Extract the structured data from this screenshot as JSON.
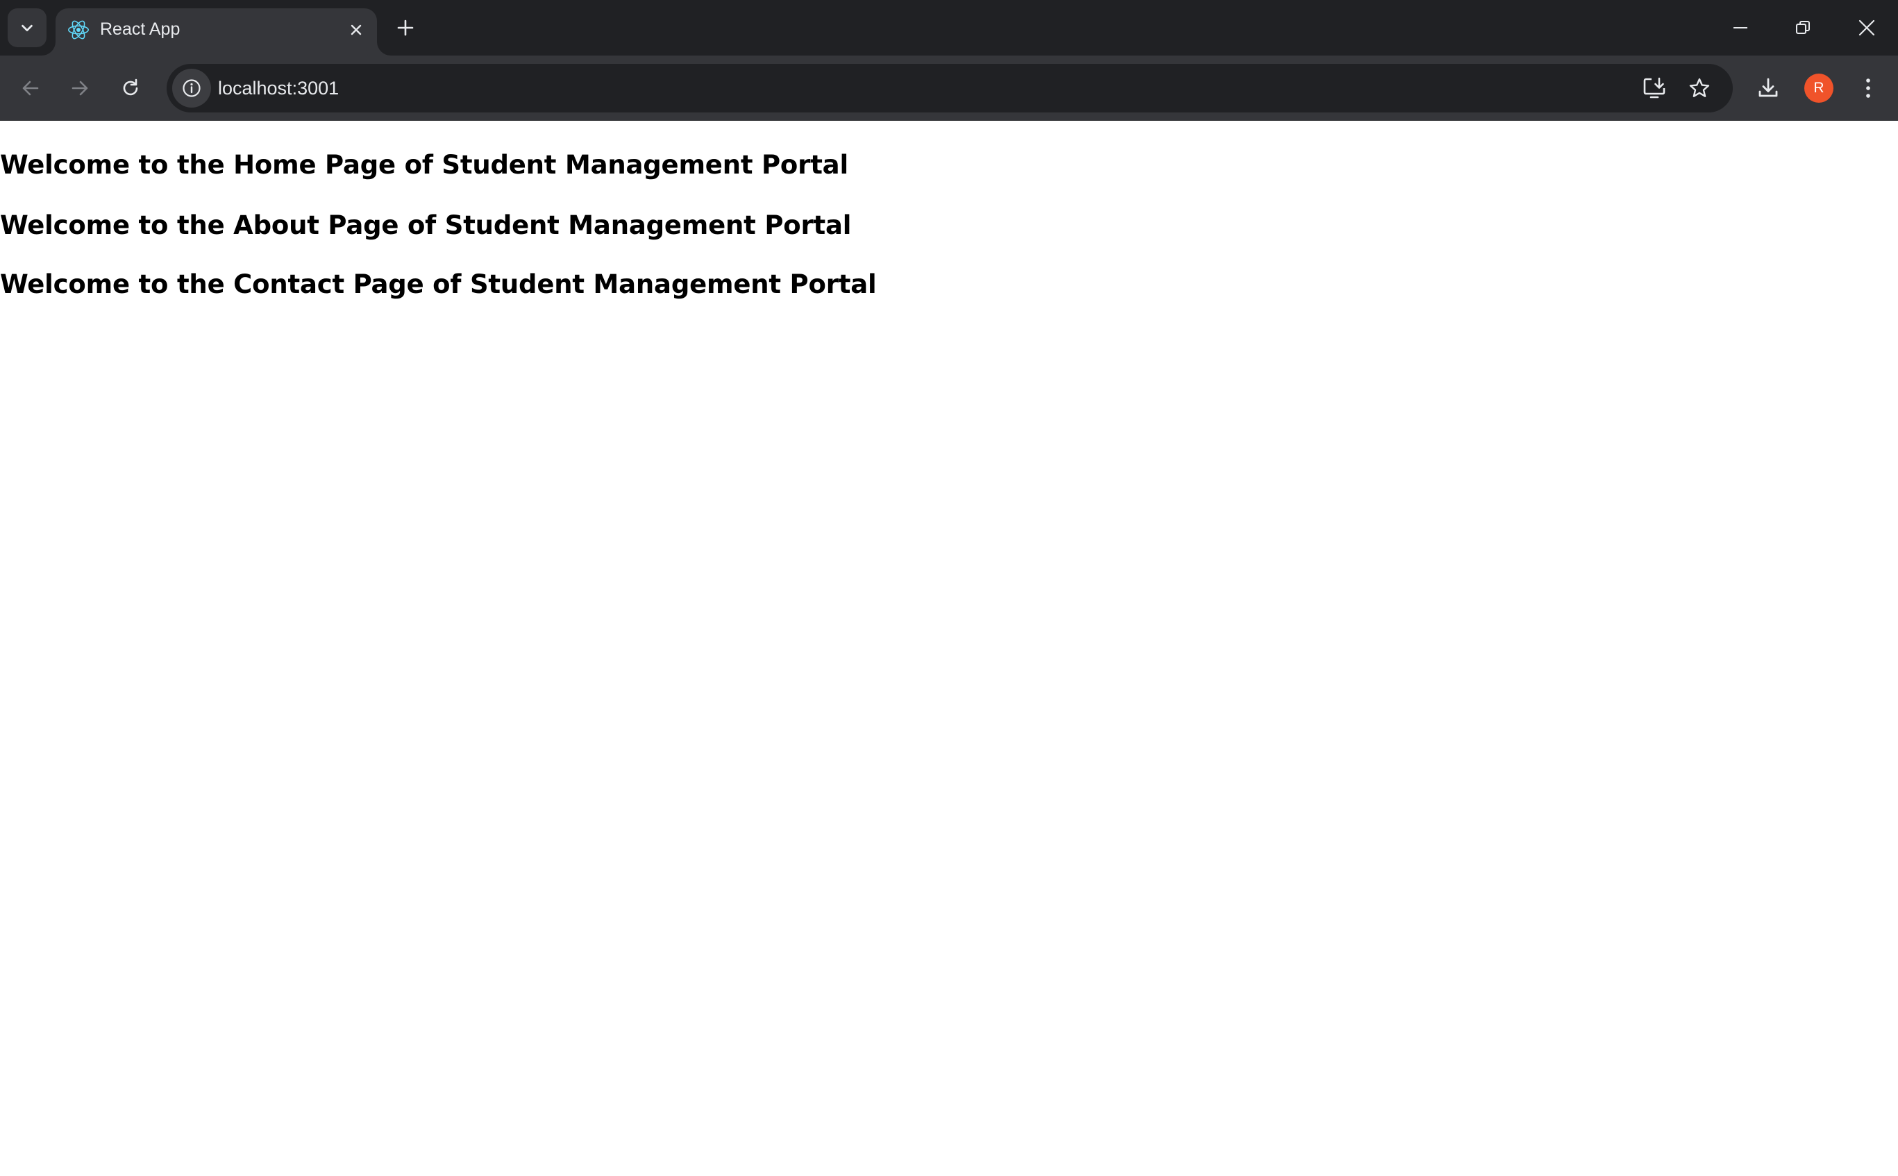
{
  "browser": {
    "tab": {
      "title": "React App",
      "favicon": "react-logo-icon"
    },
    "address_bar": {
      "url": "localhost:3001"
    },
    "profile_initial": "R",
    "colors": {
      "frame": "#202124",
      "toolbar": "#35363a",
      "omnibox": "#202124",
      "avatar": "#f0532a",
      "react_blue": "#61dafb"
    }
  },
  "page": {
    "headings": {
      "home": "Welcome to the Home Page of Student Management Portal",
      "about": "Welcome to the About Page of Student Management Portal",
      "contact": "Welcome to the Contact Page of Student Management Portal"
    }
  }
}
